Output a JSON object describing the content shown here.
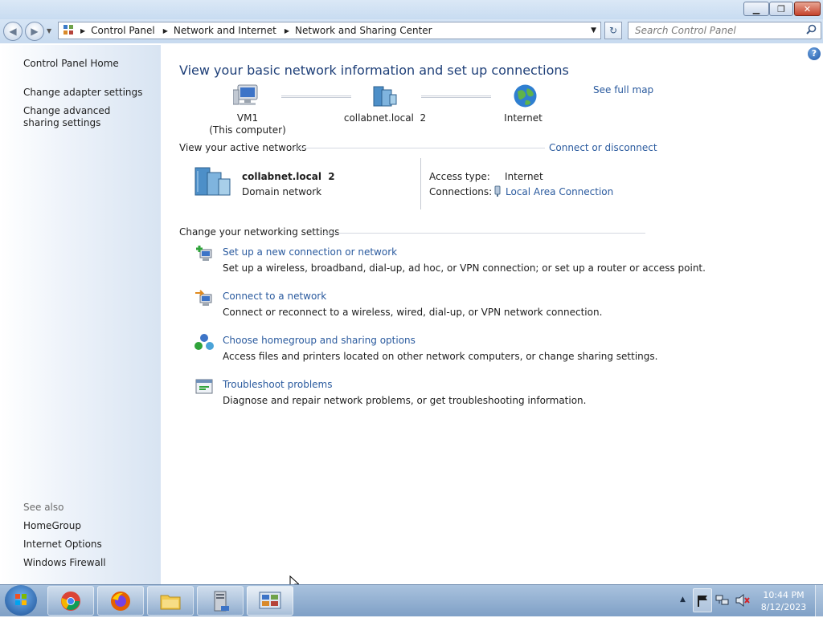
{
  "window": {
    "minimize": "▁",
    "maximize": "❐",
    "close": "✕"
  },
  "address": {
    "crumbs": [
      "Control Panel",
      "Network and Internet",
      "Network and Sharing Center"
    ],
    "search_placeholder": "Search Control Panel"
  },
  "left": {
    "home": "Control Panel Home",
    "items": [
      "Change adapter settings",
      "Change advanced sharing settings"
    ],
    "see_also_title": "See also",
    "see_also": [
      "HomeGroup",
      "Internet Options",
      "Windows Firewall"
    ]
  },
  "main": {
    "title": "View your basic network information and set up connections",
    "see_full_map": "See full map",
    "map": {
      "computer_name": "VM1",
      "computer_note": "(This computer)",
      "network_name": "collabnet.local  2",
      "internet": "Internet"
    },
    "active_title": "View your active networks",
    "connect_link": "Connect or disconnect",
    "network": {
      "name": "collabnet.local  2",
      "type": "Domain network",
      "access_label": "Access type:",
      "access_value": "Internet",
      "connections_label": "Connections:",
      "connections_value": "Local Area Connection"
    },
    "change_title": "Change your networking settings",
    "tasks": [
      {
        "link": "Set up a new connection or network",
        "desc": "Set up a wireless, broadband, dial-up, ad hoc, or VPN connection; or set up a router or access point.",
        "icon": "new-connection-icon"
      },
      {
        "link": "Connect to a network",
        "desc": "Connect or reconnect to a wireless, wired, dial-up, or VPN network connection.",
        "icon": "connect-network-icon"
      },
      {
        "link": "Choose homegroup and sharing options",
        "desc": "Access files and printers located on other network computers, or change sharing settings.",
        "icon": "homegroup-icon"
      },
      {
        "link": "Troubleshoot problems",
        "desc": "Diagnose and repair network problems, or get troubleshooting information.",
        "icon": "troubleshoot-icon"
      }
    ]
  },
  "taskbar": {
    "apps": [
      "start-orb-icon",
      "chrome-icon",
      "firefox-icon",
      "explorer-icon",
      "server-manager-icon",
      "control-panel-icon"
    ],
    "time": "10:44 PM",
    "date": "8/12/2023"
  },
  "colors": {
    "link": "#2a5a9e",
    "title": "#1e3f78"
  }
}
